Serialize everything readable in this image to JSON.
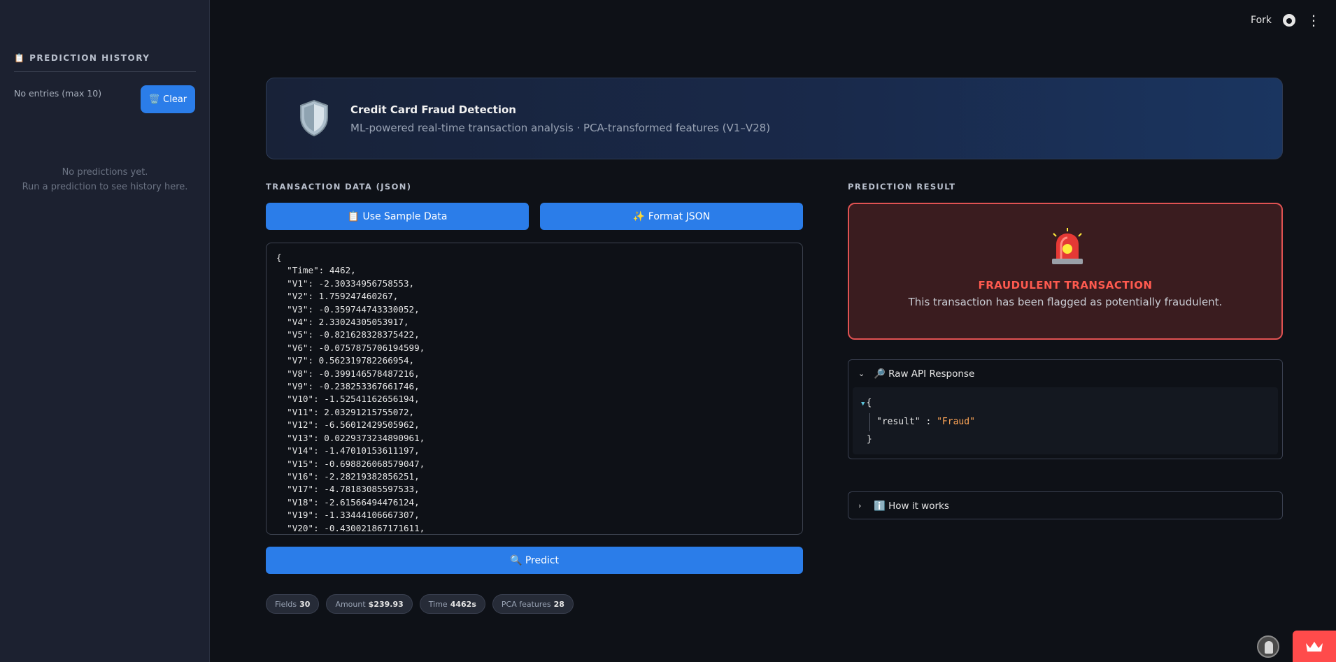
{
  "topbar": {
    "fork_label": "Fork"
  },
  "sidebar": {
    "title": "📋 PREDICTION HISTORY",
    "count_label": "No entries (max 10)",
    "clear_label": "🗑️ Clear",
    "empty_line1": "No predictions yet.",
    "empty_line2": "Run a prediction to see history here."
  },
  "banner": {
    "title": "Credit Card Fraud Detection",
    "subtitle": "ML-powered real-time transaction analysis · PCA-transformed features (V1–V28)"
  },
  "input": {
    "section_label": "TRANSACTION DATA (JSON)",
    "sample_button": "📋 Use Sample Data",
    "format_button": "✨ Format JSON",
    "json_text": "{\n  \"Time\": 4462,\n  \"V1\": -2.30334956758553,\n  \"V2\": 1.759247460267,\n  \"V3\": -0.359744743330052,\n  \"V4\": 2.33024305053917,\n  \"V5\": -0.821628328375422,\n  \"V6\": -0.0757875706194599,\n  \"V7\": 0.562319782266954,\n  \"V8\": -0.399146578487216,\n  \"V9\": -0.238253367661746,\n  \"V10\": -1.52541162656194,\n  \"V11\": 2.03291215755072,\n  \"V12\": -6.56012429505962,\n  \"V13\": 0.0229373234890961,\n  \"V14\": -1.47010153611197,\n  \"V15\": -0.698826068579047,\n  \"V16\": -2.28219382856251,\n  \"V17\": -4.78183085597533,\n  \"V18\": -2.61566494476124,\n  \"V19\": -1.33444106667307,\n  \"V20\": -0.430021867171611,",
    "predict_button": "🔍 Predict"
  },
  "stats": [
    {
      "label": "Fields",
      "value": "30"
    },
    {
      "label": "Amount",
      "value": "$239.93"
    },
    {
      "label": "Time",
      "value": "4462s"
    },
    {
      "label": "PCA features",
      "value": "28"
    }
  ],
  "result": {
    "section_label": "PREDICTION RESULT",
    "icon": "siren-icon",
    "title": "FRAUDULENT TRANSACTION",
    "description": "This transaction has been flagged as potentially fraudulent.",
    "accent_color": "#ff5a4f"
  },
  "raw_response": {
    "header": "🔎 Raw API Response",
    "open_brace": "{",
    "key": "\"result\"",
    "colon": " : ",
    "value": "\"Fraud\"",
    "close_brace": "}"
  },
  "how_it_works": {
    "header": "ℹ️ How it works"
  },
  "colors": {
    "accent": "#2b7de9",
    "background": "#0e1117",
    "sidebar": "#1c2130",
    "danger": "#ff4b4b"
  }
}
